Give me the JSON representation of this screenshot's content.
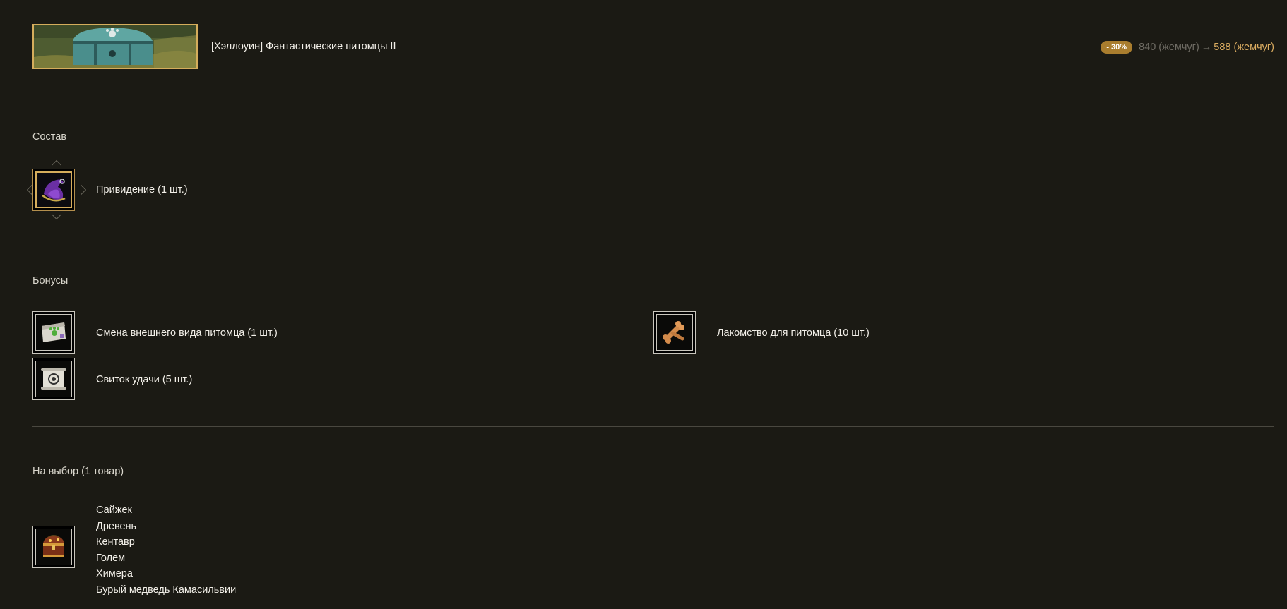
{
  "product": {
    "title": "[Хэллоуин] Фантастические питомцы II",
    "banner_icon": "treasure-chest-image"
  },
  "price": {
    "discount": "- 30%",
    "old": "840 (жемчуг)",
    "arrow": "→",
    "new": "588 (жемчуг)",
    "accent_color": "#dcad61",
    "badge_color": "#a97d2e"
  },
  "sections": {
    "composition": {
      "title": "Состав",
      "items": [
        {
          "label": "Привидение (1 шт.)",
          "icon": "witch-hat-icon"
        }
      ]
    },
    "bonuses": {
      "title": "Бонусы",
      "items": [
        {
          "label": "Смена внешнего вида питомца (1 шт.)",
          "icon": "pet-appearance-ticket-icon"
        },
        {
          "label": "Лакомство для питомца (10 шт.)",
          "icon": "pet-treat-bone-icon"
        },
        {
          "label": "Свиток удачи (5 шт.)",
          "icon": "luck-scroll-icon"
        }
      ]
    },
    "choice": {
      "title": "На выбор (1 товар)",
      "icon": "treasure-chest-icon",
      "options": [
        "Сайжек",
        "Древень",
        "Кентавр",
        "Голем",
        "Химера",
        "Бурый медведь Камасильвии"
      ]
    }
  }
}
